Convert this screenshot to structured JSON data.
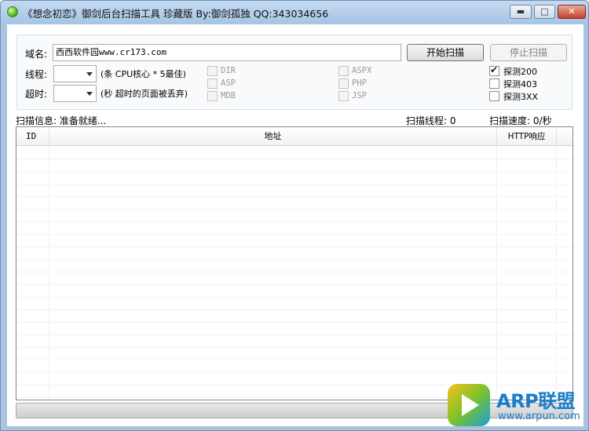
{
  "window": {
    "title": "《想念初恋》御剑后台扫描工具 珍藏版 By:御剑孤独 QQ:343034656",
    "minimize_glyph": "▬",
    "maximize_glyph": "□",
    "close_glyph": "✕"
  },
  "form": {
    "domain_label": "域名:",
    "domain_value": "西西软件园www.cr173.com",
    "threads_label": "线程:",
    "threads_hint": "(条 CPU核心 * 5最佳)",
    "timeout_label": "超时:",
    "timeout_hint": "(秒 超时的页面被丢弃)",
    "start_button": "开始扫描",
    "stop_button": "停止扫描"
  },
  "dict_options": [
    {
      "label": "DIR",
      "checked": false,
      "enabled": false
    },
    {
      "label": "ASP",
      "checked": false,
      "enabled": false
    },
    {
      "label": "MDB",
      "checked": false,
      "enabled": false
    },
    {
      "label": "ASPX",
      "checked": false,
      "enabled": false
    },
    {
      "label": "PHP",
      "checked": false,
      "enabled": false
    },
    {
      "label": "JSP",
      "checked": false,
      "enabled": false
    }
  ],
  "detect_options": [
    {
      "label": "探测200",
      "checked": true
    },
    {
      "label": "探测403",
      "checked": false
    },
    {
      "label": "探测3XX",
      "checked": false
    }
  ],
  "status": {
    "info": "扫描信息: 准备就绪...",
    "threads": "扫描线程: 0",
    "speed": "扫描速度: 0/秒"
  },
  "table": {
    "columns": [
      "ID",
      "地址",
      "HTTP响应"
    ],
    "rows": []
  },
  "progress": {
    "fraction": 0
  },
  "watermark": {
    "title": "ARP联盟",
    "url": "www.arpun.com"
  },
  "colors": {
    "titlebar": "#a7c4e4",
    "progress_fill": "#4fbf2b",
    "watermark": "#1a7fc9"
  }
}
